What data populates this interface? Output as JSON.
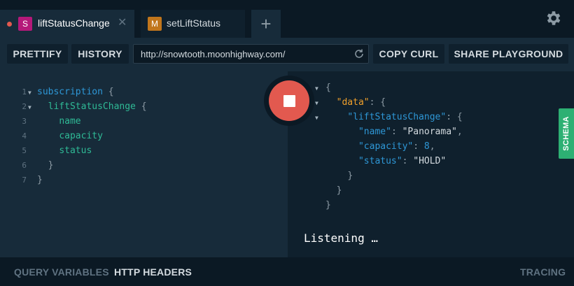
{
  "tabs": [
    {
      "badge": "S",
      "label": "liftStatusChange",
      "badge_color": "#b5197a",
      "dot_color": "#e2594f",
      "active": true
    },
    {
      "badge": "M",
      "label": "setLiftStatus",
      "badge_color": "#c1761c",
      "active": false
    }
  ],
  "tab_close_glyph": "✕",
  "tab_add_glyph": "+",
  "toolbar": {
    "prettify_label": "PRETTIFY",
    "history_label": "HISTORY",
    "url_value": "http://snowtooth.moonhighway.com/",
    "copy_curl_label": "COPY CURL",
    "share_label": "SHARE PLAYGROUND"
  },
  "query_editor": {
    "line_numbers": [
      "1",
      "2",
      "3",
      "4",
      "5",
      "6",
      "7"
    ],
    "lines": [
      {
        "keyword": "subscription",
        "brace": "{"
      },
      {
        "field": "liftStatusChange",
        "brace": "{"
      },
      {
        "field": "name"
      },
      {
        "field": "capacity"
      },
      {
        "field": "status"
      },
      {
        "brace": "}"
      },
      {
        "brace": "}"
      }
    ]
  },
  "result": {
    "open_brace": "{",
    "data_key": "\"data\"",
    "lift_key": "\"liftStatusChange\"",
    "name_key": "\"name\"",
    "name_value": "\"Panorama\"",
    "capacity_key": "\"capacity\"",
    "capacity_value": "8",
    "status_key": "\"status\"",
    "status_value": "\"HOLD\"",
    "close_brace": "}",
    "colon": ": ",
    "comma": ","
  },
  "listening_text": "Listening …",
  "schema_label": "SCHEMA",
  "footer": {
    "query_variables": "QUERY VARIABLES",
    "http_headers": "HTTP HEADERS",
    "tracing": "TRACING"
  },
  "colors": {
    "stop_button": "#e2594f",
    "schema_tab": "#2db073",
    "keyword": "#2e97d6",
    "field": "#2fba96",
    "data_key": "#f0a02b"
  },
  "icons": {
    "settings": "gear-icon",
    "reload": "reload-icon",
    "stop": "stop-icon",
    "fold": "chevron-down-icon"
  }
}
